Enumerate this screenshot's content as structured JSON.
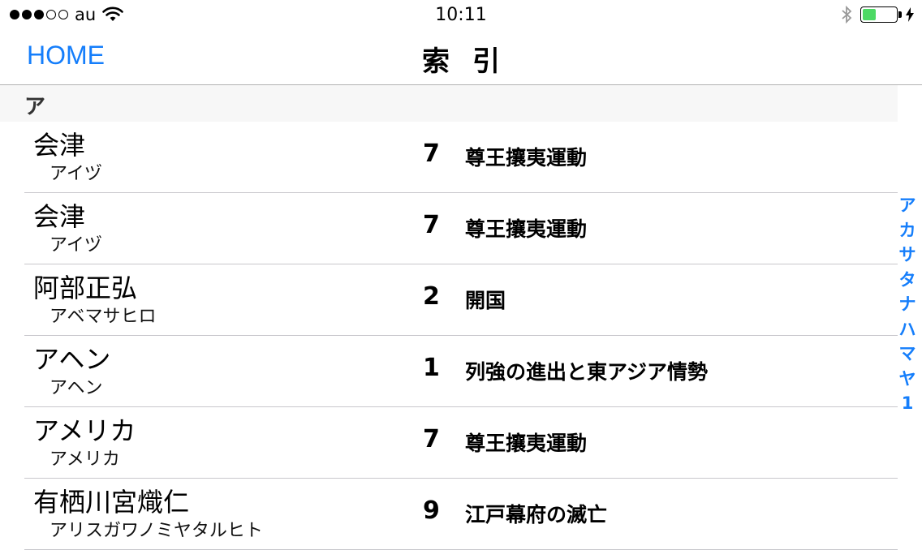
{
  "status_bar": {
    "carrier": "au",
    "time": "10:11",
    "signal_bars": 3,
    "signal_total": 5,
    "battery_level": 0.4
  },
  "nav": {
    "back_label": "HOME",
    "title": "索引"
  },
  "section": {
    "header": "ア"
  },
  "rows": [
    {
      "term": "会津",
      "reading": "アイヅ",
      "chapter": "7",
      "chapter_title": "尊王攘夷運動"
    },
    {
      "term": "会津",
      "reading": "アイヅ",
      "chapter": "7",
      "chapter_title": "尊王攘夷運動"
    },
    {
      "term": "阿部正弘",
      "reading": "アベマサヒロ",
      "chapter": "2",
      "chapter_title": "開国"
    },
    {
      "term": "アヘン",
      "reading": "アヘン",
      "chapter": "1",
      "chapter_title": "列強の進出と東アジア情勢"
    },
    {
      "term": "アメリカ",
      "reading": "アメリカ",
      "chapter": "7",
      "chapter_title": "尊王攘夷運動"
    },
    {
      "term": "有栖川宮熾仁",
      "reading": "アリスガワノミヤタルヒト",
      "chapter": "9",
      "chapter_title": "江戸幕府の滅亡"
    }
  ],
  "index_letters": [
    "ア",
    "カ",
    "サ",
    "タ",
    "ナ",
    "ハ",
    "マ",
    "ヤ",
    "1"
  ],
  "colors": {
    "accent": "#157efb",
    "battery": "#4cd964",
    "section_bg": "#f7f7f7",
    "separator": "#c8c7cc"
  },
  "icons": [
    "signal-dots-icon",
    "wifi-icon",
    "bluetooth-icon",
    "battery-icon",
    "charging-bolt-icon"
  ]
}
